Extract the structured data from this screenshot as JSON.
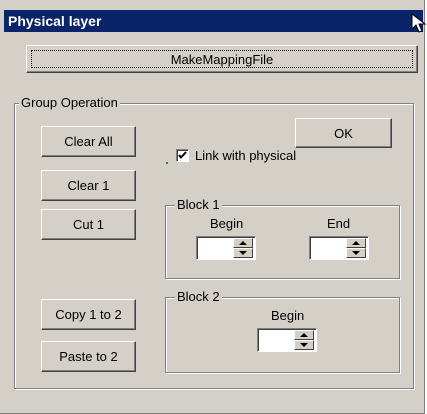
{
  "window": {
    "title": "Physical layer"
  },
  "mapping_button": {
    "label": "MakeMappingFile"
  },
  "group_operation": {
    "legend": "Group Operation",
    "clear_all": "Clear All",
    "clear_1": "Clear 1",
    "cut_1": "Cut 1",
    "copy_1_to_2": "Copy 1 to 2",
    "paste_to_2": "Paste to 2",
    "ok": "OK",
    "link_with_physical": {
      "label": "Link with physical",
      "checked": true
    }
  },
  "block1": {
    "legend": "Block 1",
    "begin_label": "Begin",
    "end_label": "End",
    "begin_value": "",
    "end_value": ""
  },
  "block2": {
    "legend": "Block 2",
    "begin_label": "Begin",
    "begin_value": ""
  },
  "colors": {
    "titlebar": "#0a246a",
    "face": "#d4d0c8"
  },
  "icons": [
    "cursor-arrow-icon",
    "checkmark-icon",
    "spin-up-icon",
    "spin-down-icon"
  ]
}
